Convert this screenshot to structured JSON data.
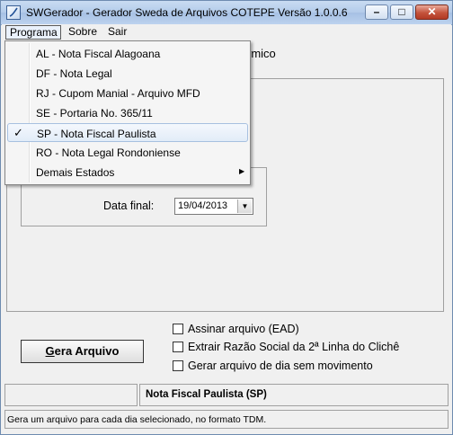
{
  "window": {
    "title": "SWGerador - Gerador Sweda de Arquivos COTEPE Versão 1.0.0.6",
    "controls": {
      "minimize": "–",
      "maximize": "□",
      "close": "✕"
    }
  },
  "menubar": {
    "programa": "Programa",
    "sobre": "Sobre",
    "sair": "Sair"
  },
  "programa_menu": {
    "items": [
      {
        "label": "AL - Nota Fiscal Alagoana"
      },
      {
        "label": "DF - Nota Legal"
      },
      {
        "label": "RJ - Cupom Manial - Arquivo MFD"
      },
      {
        "label": "SE - Portaria No. 365/11"
      },
      {
        "label": "SP - Nota Fiscal Paulista",
        "checked": true
      },
      {
        "label": "RO - Nota Legal Rondoniense"
      },
      {
        "label": "Demais Estados",
        "submenu": true
      }
    ],
    "check_glyph": "✓",
    "submenu_glyph": "▶"
  },
  "main": {
    "partial_label": "rmico",
    "data_final_label": "Data final:",
    "data_final_value": "19/04/2013",
    "dropdown_glyph": "▼",
    "gera_button": {
      "underlined": "G",
      "rest": "era Arquivo"
    },
    "checkboxes": [
      "Assinar arquivo (EAD)",
      "Extrair Razão Social da 2ª Linha do Clichê",
      "Gerar arquivo de dia sem movimento"
    ]
  },
  "status": {
    "selected_program": "Nota Fiscal Paulista (SP)",
    "hint": "Gera um arquivo para cada dia selecionado, no formato TDM."
  }
}
